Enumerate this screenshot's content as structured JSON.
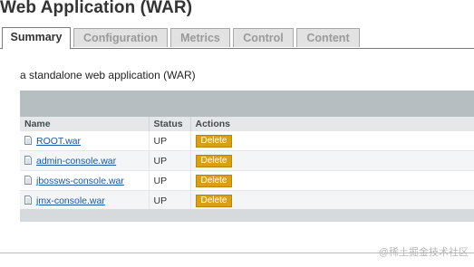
{
  "page": {
    "title": "Web Application (WAR)"
  },
  "tabs": [
    {
      "label": "Summary",
      "active": true
    },
    {
      "label": "Configuration",
      "active": false
    },
    {
      "label": "Metrics",
      "active": false
    },
    {
      "label": "Control",
      "active": false
    },
    {
      "label": "Content",
      "active": false
    }
  ],
  "description": "a standalone web application (WAR)",
  "table": {
    "headers": {
      "name": "Name",
      "status": "Status",
      "actions": "Actions"
    },
    "rows": [
      {
        "name": "ROOT.war",
        "status": "UP",
        "action": "Delete"
      },
      {
        "name": "admin-console.war",
        "status": "UP",
        "action": "Delete"
      },
      {
        "name": "jbossws-console.war",
        "status": "UP",
        "action": "Delete"
      },
      {
        "name": "jmx-console.war",
        "status": "UP",
        "action": "Delete"
      }
    ]
  },
  "watermark": "@稀土掘金技术社区",
  "colors": {
    "delete_button": "#d9a013",
    "link": "#1a56a8",
    "panel_header": "#b6bec2"
  }
}
